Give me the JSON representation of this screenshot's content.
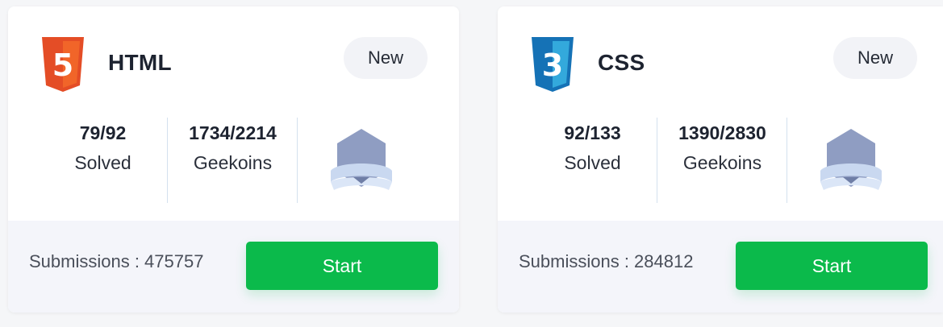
{
  "cards": [
    {
      "title": "HTML",
      "badge": "New",
      "logo_icon": "html5-icon",
      "logo_color": "#e44d26",
      "logo_number": "5",
      "solved_value": "79/92",
      "solved_label": "Solved",
      "geekoins_value": "1734/2214",
      "geekoins_label": "Geekoins",
      "medal_icon": "medal-badge-icon",
      "submissions": "Submissions : 475757",
      "start_label": "Start"
    },
    {
      "title": "CSS",
      "badge": "New",
      "logo_icon": "css3-icon",
      "logo_color": "#1572b6",
      "logo_number": "3",
      "solved_value": "92/133",
      "solved_label": "Solved",
      "geekoins_value": "1390/2830",
      "geekoins_label": "Geekoins",
      "medal_icon": "medal-badge-icon",
      "submissions": "Submissions : 284812",
      "start_label": "Start"
    }
  ],
  "colors": {
    "start_button": "#0bba4b",
    "badge_bg": "#f2f3f7",
    "footer_bg": "#f4f5fa"
  }
}
